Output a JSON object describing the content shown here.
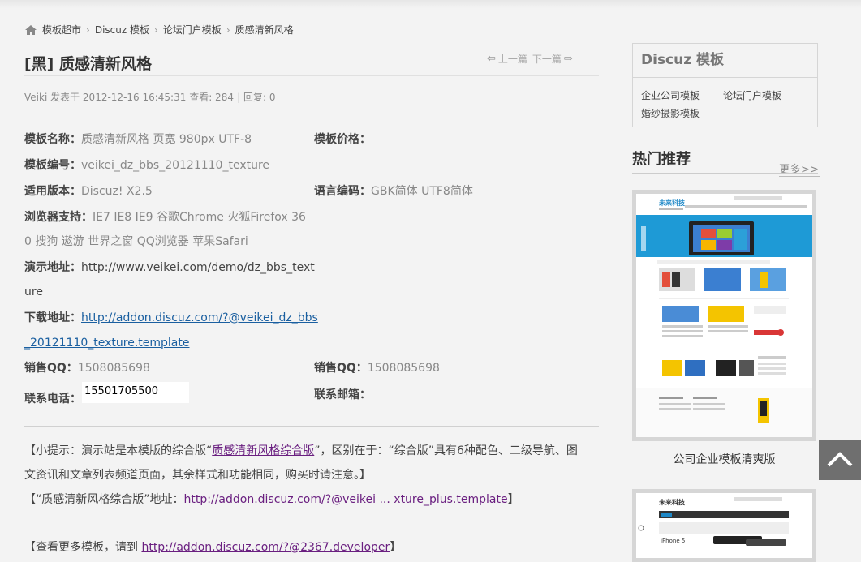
{
  "breadcrumb": [
    "模板超市",
    "Discuz 模板",
    "论坛门户模板",
    "质感清新风格"
  ],
  "title": "[黑] 质感清新风格",
  "nav": {
    "prev": "上一篇",
    "next": "下一篇"
  },
  "meta": {
    "author": "Veiki",
    "posted": "发表于 2012-12-16 16:45:31",
    "views": "查看: 284",
    "replies": "回复: 0"
  },
  "info": {
    "name_k": "模板名称：",
    "name_v": "质感清新风格 页宽 980px UTF-8",
    "price_k": "模板价格：",
    "code_k": "模板编号：",
    "code_v": "veikei_dz_bbs_20121110_texture",
    "ver_k": "适用版本：",
    "ver_v": "Discuz! X2.5",
    "lang_k": "语言编码：",
    "lang_v": "GBK简体 UTF8简体",
    "browser_k": "浏览器支持：",
    "browser_v1": "IE7 IE8 IE9 谷歌Chrome 火狐Firefox 36",
    "browser_v2": "0 搜狗 遨游 世界之窗 QQ浏览器 苹果Safari",
    "demo_k": "演示地址：",
    "demo_v1": "http://www.veikei.com/demo/dz_bbs_text",
    "demo_v2": "ure",
    "dl_k": "下载地址：",
    "dl_v1": "http://addon.discuz.com/?@veikei_dz_bbs",
    "dl_v2": "_20121110_texture.template",
    "qq1_k": "销售QQ：",
    "qq1_v": "1508085698",
    "qq2_k": "销售QQ：",
    "qq2_v": "1508085698",
    "phone_k": "联系电话：",
    "phone_v": "15501705500",
    "mail_k": "联系邮箱："
  },
  "tip": {
    "l1a": "【小提示：演示站是本模版的综合版“",
    "l1link": "质感清新风格综合版",
    "l1b": "”，区别在于：“综合版”具有6种配色、二级导航、图",
    "l2": "文资讯和文章列表频道页面，其余样式和功能相同，购买时请注意。】",
    "l3a": "【“质感清新风格综合版”地址：",
    "l3link": "http://addon.discuz.com/?@veikei ... xture_plus.template",
    "l3b": "】",
    "l4a": "【查看更多模板，请到 ",
    "l4link": "http://addon.discuz.com/?@2367.developer",
    "l4b": "】"
  },
  "sidebar": {
    "box_title": "Discuz 模板",
    "items": [
      "企业公司模板",
      "论坛门户模板",
      "婚纱摄影模板"
    ],
    "hot_title": "热门推荐",
    "more": "更多>>",
    "thumb1_caption": "公司企业模板清爽版",
    "thumb_brand": "未来科技",
    "thumb_phone": "iPhone 5"
  },
  "colors": {
    "accent_link": "#1a5fa0",
    "visited_link": "#6a1f80",
    "banner": "#1e9ad6",
    "totop_bg": "#6f6f6f"
  }
}
